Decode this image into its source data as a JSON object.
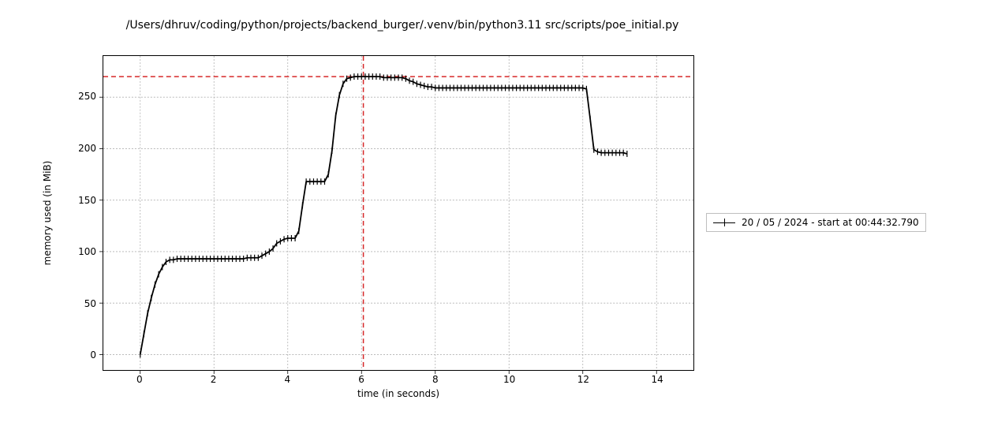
{
  "chart_data": {
    "type": "line",
    "title": "/Users/dhruv/coding/python/projects/backend_burger/.venv/bin/python3.11 src/scripts/poe_initial.py",
    "xlabel": "time (in seconds)",
    "ylabel": "memory used (in MiB)",
    "xlim": [
      -1,
      15
    ],
    "ylim": [
      -15,
      290
    ],
    "xticks": [
      0,
      2,
      4,
      6,
      8,
      10,
      12,
      14
    ],
    "yticks": [
      0,
      50,
      100,
      150,
      200,
      250
    ],
    "reference_lines": {
      "peak_memory_hline_y": 270,
      "peak_time_vline_x": 6.05
    },
    "series": [
      {
        "name": "20 / 05 / 2024 - start at 00:44:32.790",
        "marker": "|",
        "x": [
          0.0,
          0.1,
          0.2,
          0.3,
          0.4,
          0.5,
          0.6,
          0.7,
          0.8,
          0.9,
          1.0,
          1.1,
          1.2,
          1.3,
          1.4,
          1.5,
          1.6,
          1.7,
          1.8,
          1.9,
          2.0,
          2.1,
          2.2,
          2.3,
          2.4,
          2.5,
          2.6,
          2.7,
          2.8,
          2.9,
          3.0,
          3.1,
          3.2,
          3.3,
          3.4,
          3.5,
          3.6,
          3.7,
          3.8,
          3.9,
          4.0,
          4.1,
          4.2,
          4.3,
          4.4,
          4.5,
          4.6,
          4.7,
          4.8,
          4.9,
          5.0,
          5.1,
          5.2,
          5.3,
          5.4,
          5.5,
          5.6,
          5.7,
          5.8,
          5.9,
          6.0,
          6.1,
          6.2,
          6.3,
          6.4,
          6.5,
          6.6,
          6.7,
          6.8,
          6.9,
          7.0,
          7.1,
          7.2,
          7.3,
          7.4,
          7.5,
          7.6,
          7.7,
          7.8,
          7.9,
          8.0,
          8.1,
          8.2,
          8.3,
          8.4,
          8.5,
          8.6,
          8.7,
          8.8,
          8.9,
          9.0,
          9.1,
          9.2,
          9.3,
          9.4,
          9.5,
          9.6,
          9.7,
          9.8,
          9.9,
          10.0,
          10.1,
          10.2,
          10.3,
          10.4,
          10.5,
          10.6,
          10.7,
          10.8,
          10.9,
          11.0,
          11.1,
          11.2,
          11.3,
          11.4,
          11.5,
          11.6,
          11.7,
          11.8,
          11.9,
          12.0,
          12.1,
          12.2,
          12.3,
          12.4,
          12.5,
          12.6,
          12.7,
          12.8,
          12.9,
          13.0,
          13.1,
          13.2
        ],
        "y": [
          0,
          20,
          40,
          55,
          68,
          78,
          85,
          90,
          92,
          92,
          93,
          93,
          93,
          93,
          93,
          93,
          93,
          93,
          93,
          93,
          93,
          93,
          93,
          93,
          93,
          93,
          93,
          93,
          93,
          94,
          94,
          94,
          94,
          96,
          98,
          100,
          103,
          108,
          110,
          112,
          113,
          113,
          113,
          120,
          145,
          168,
          168,
          168,
          168,
          168,
          168,
          175,
          198,
          232,
          252,
          263,
          268,
          269,
          270,
          270,
          270,
          270,
          270,
          270,
          270,
          270,
          269,
          269,
          269,
          269,
          269,
          269,
          268,
          266,
          265,
          263,
          262,
          261,
          260,
          260,
          259,
          259,
          259,
          259,
          259,
          259,
          259,
          259,
          259,
          259,
          259,
          259,
          259,
          259,
          259,
          259,
          259,
          259,
          259,
          259,
          259,
          259,
          259,
          259,
          259,
          259,
          259,
          259,
          259,
          259,
          259,
          259,
          259,
          259,
          259,
          259,
          259,
          259,
          259,
          259,
          259,
          258,
          229,
          199,
          197,
          196,
          196,
          196,
          196,
          196,
          196,
          196,
          195
        ]
      }
    ],
    "legend": {
      "position": "right",
      "entries": [
        "20 / 05 / 2024 - start at 00:44:32.790"
      ]
    }
  }
}
